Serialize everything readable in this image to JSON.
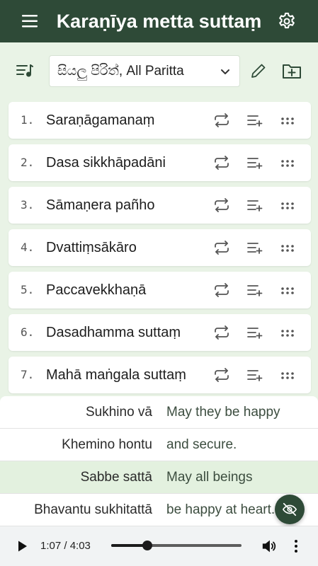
{
  "header": {
    "title": "Karaṇīya metta suttaṃ",
    "menu_icon": "hamburger-menu-icon",
    "settings_icon": "gear-icon"
  },
  "toolbar": {
    "collection_value": "සියලු පිරිත්, All Paritta",
    "sort_icon": "playlist-music-icon",
    "edit_icon": "pencil-icon",
    "add_icon": "folder-add-icon"
  },
  "tracks": [
    {
      "number": "1.",
      "name": "Saraṇāgamanaṃ"
    },
    {
      "number": "2.",
      "name": "Dasa sikkhāpadāni"
    },
    {
      "number": "3.",
      "name": "Sāmaṇera pañho"
    },
    {
      "number": "4.",
      "name": "Dvattiṃsākāro"
    },
    {
      "number": "5.",
      "name": "Paccavekkhaṇā"
    },
    {
      "number": "6.",
      "name": "Dasadhamma suttaṃ"
    },
    {
      "number": "7.",
      "name": "Mahā maṅgala suttaṃ"
    }
  ],
  "lyrics": [
    {
      "pali": "Sukhino vā",
      "english": "May they be happy",
      "highlighted": false
    },
    {
      "pali": "Khemino hontu",
      "english": "and secure.",
      "highlighted": false
    },
    {
      "pali": "Sabbe sattā",
      "english": "May all beings",
      "highlighted": true
    },
    {
      "pali": "Bhavantu sukhitattā",
      "english": "be happy at heart.",
      "highlighted": false
    }
  ],
  "player": {
    "time": "1:07 / 4:03",
    "progress_fraction": 0.276
  },
  "colors": {
    "primary": "#2e4a37",
    "background": "#e9f3e6",
    "highlight": "#e3f1df"
  }
}
